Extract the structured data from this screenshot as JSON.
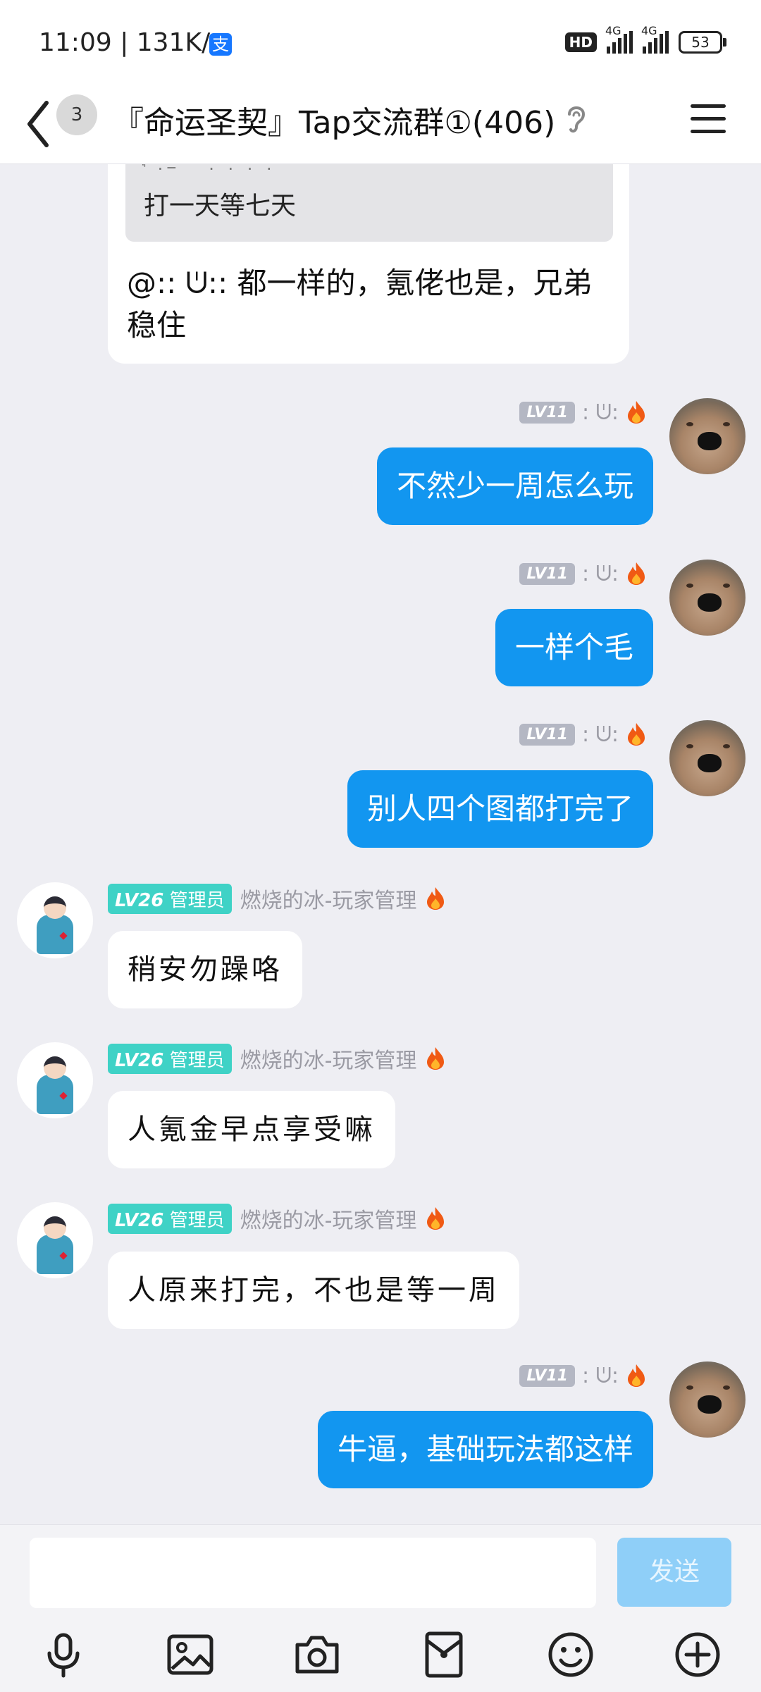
{
  "status_bar": {
    "time": "11:09 | 131K/s",
    "pay_icon": "支",
    "hd": "HD",
    "signal1_label": "4G",
    "signal2_label": "4G",
    "battery": "53"
  },
  "nav": {
    "badge": "3",
    "title": "『命运圣契』Tap交流群①(406)"
  },
  "chat": {
    "partial_message": {
      "quote_header": "ꜗ ·ⲻ ̈ ̈  ·  ·  ·  ·",
      "quote_text": "打一天等七天",
      "text_line1": "@꞉꞉ ᕫ꞉꞉ 都一样的，氪佬也是，兄弟",
      "text_line2": "稳住"
    },
    "user_level": "LV11",
    "user_nick": "꞉ ᕫ꞉",
    "admin_level": "LV26",
    "admin_role": "管理员",
    "admin_nick": "燃烧的冰-玩家管理",
    "messages": [
      {
        "side": "right",
        "text": "不然少一周怎么玩"
      },
      {
        "side": "right",
        "text": "一样个毛"
      },
      {
        "side": "right",
        "text": "别人四个图都打完了"
      },
      {
        "side": "left",
        "text": "稍安勿躁咯"
      },
      {
        "side": "left",
        "text": "人氪金早点享受嘛"
      },
      {
        "side": "left",
        "text": "人原来打完，不也是等一周"
      },
      {
        "side": "right",
        "text": "牛逼，基础玩法都这样"
      }
    ]
  },
  "composer": {
    "input_value": "",
    "send_label": "发送"
  },
  "icons": [
    "microphone-icon",
    "image-icon",
    "camera-icon",
    "red-packet-icon",
    "emoji-icon",
    "plus-icon"
  ],
  "colors": {
    "bubble_blue": "#1296f0",
    "admin_badge": "#3fd2c6",
    "background": "#eeeef3"
  }
}
